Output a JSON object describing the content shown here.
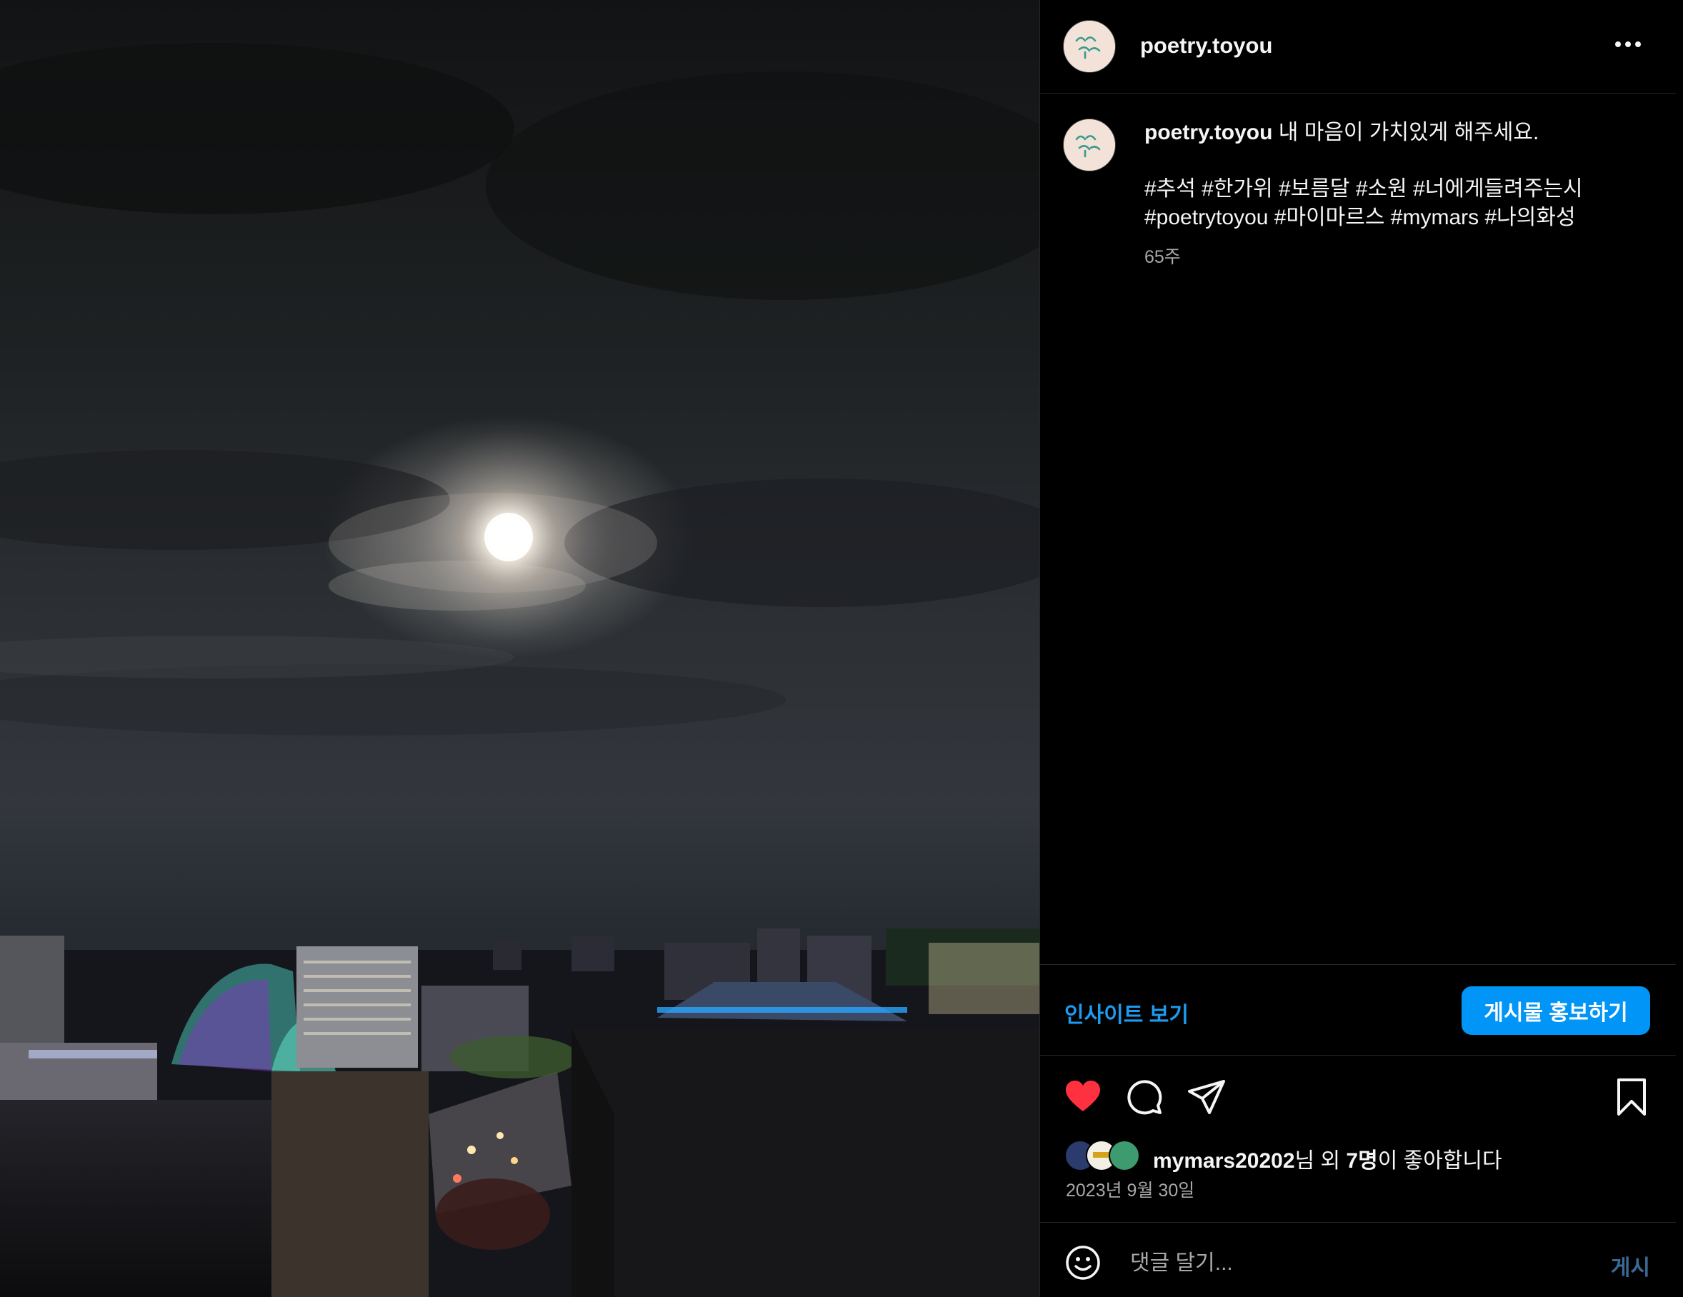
{
  "post": {
    "username": "poetry.toyou",
    "caption_text": "내 마음이 가치있게 해주세요.",
    "hashtags_line1": "#추석 #한가위 #보름달 #소원 #너에게들려주는시",
    "hashtags_line2": "#poetrytoyou #마이마르스 #mymars #나의화성",
    "age": "65주"
  },
  "actions": {
    "insights_label": "인사이트 보기",
    "promote_label": "게시물 홍보하기",
    "icons": [
      "heart-filled-icon",
      "comment-icon",
      "share-icon",
      "bookmark-icon"
    ]
  },
  "likes": {
    "user": "mymars20202",
    "suffix_a": "님 외 ",
    "count": "7명",
    "suffix_b": "이 좋아합니다",
    "date": "2023년 9월 30일"
  },
  "comment": {
    "placeholder": "댓글 달기...",
    "post_label": "게시"
  },
  "colors": {
    "accent": "#0095f6",
    "link": "#1d9bf0",
    "like": "#ff3040",
    "muted": "#a8a8a8"
  }
}
